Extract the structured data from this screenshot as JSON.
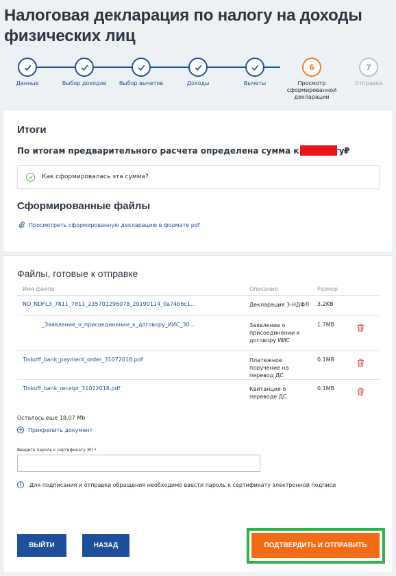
{
  "page": {
    "title": "Налоговая декларация по налогу на доходы физических лиц"
  },
  "steps": [
    {
      "label": "Данные",
      "state": "done",
      "icon": "check-icon"
    },
    {
      "label": "Выбор доходов",
      "state": "done",
      "icon": "check-icon"
    },
    {
      "label": "Выбор вычетов",
      "state": "done",
      "icon": "check-icon"
    },
    {
      "label": "Доходы",
      "state": "done",
      "icon": "check-icon"
    },
    {
      "label": "Вычеты",
      "state": "done",
      "icon": "check-icon"
    },
    {
      "number": "6",
      "label": "Просмотр сформированной декларации",
      "state": "current"
    },
    {
      "number": "7",
      "label": "Отправка",
      "state": "future"
    }
  ],
  "results": {
    "heading": "Итоги",
    "refund_text": "По итогам предварительного расчета определена сумма к возврату",
    "currency": "₽",
    "how_formed": "Как сформировалась эта сумма?",
    "redaction_color": "#e8141b"
  },
  "generated": {
    "heading": "Сформированные файлы",
    "pdf_link": "Просмотреть сформированную декларацию в формате pdf"
  },
  "ready": {
    "heading": "Файлы, готовые к отправке",
    "columns": {
      "name": "Имя файла",
      "description": "Описание",
      "size": "Размер"
    },
    "files": [
      {
        "name": "NO_NDFL3_7811_7811_235701296078_20190114_0a74b6c1...",
        "description": "Декларация 3-НДФЛ",
        "size": "3.2KB",
        "deletable": false
      },
      {
        "name": "_Заявление_о_присоединении_к_договору_ИИС_30...",
        "description": "Заявление о присоединении к договору ИИС",
        "size": "1.7MB",
        "deletable": true
      },
      {
        "name": "Tinkoff_bank_payment_order_31072018.pdf",
        "description": "Платежное поручение на перевод ДС",
        "size": "0.1MB",
        "deletable": true
      },
      {
        "name": "Tinkoff_bank_receipt_31072018.pdf",
        "description": "Квитанция о переводе ДС",
        "size": "0.1MB",
        "deletable": true
      }
    ],
    "remaining": "Осталось еще 18.07 Mb",
    "attach": "Прикрепить документ",
    "password_label": "Введите пароль к сертификату ЭП *",
    "password_value": "",
    "info_text": "Для подписания и отправки обращения необходимо ввести пароль к сертификату электронной подписи"
  },
  "actions": {
    "exit": "ВЫЙТИ",
    "back": "НАЗАД",
    "confirm": "ПОДТВЕРДИТЬ И ОТПРАВИТЬ"
  },
  "colors": {
    "primary": "#1e4f9a",
    "accent": "#f26b16",
    "highlight": "#2eb34a",
    "delete": "#e2483b"
  }
}
